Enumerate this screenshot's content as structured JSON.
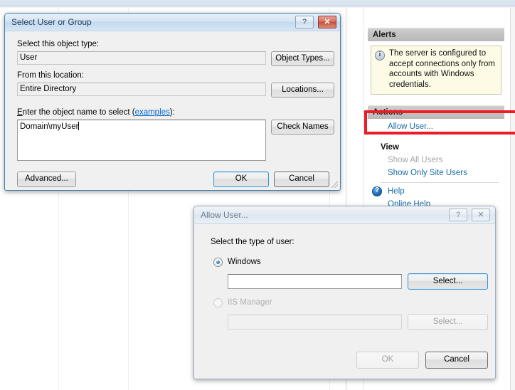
{
  "background": {
    "right_panel": {
      "alerts": {
        "header": "Alerts",
        "icon": "info-icon",
        "message": "The server is configured to accept connections only from accounts with Windows credentials."
      },
      "actions": {
        "header": "Actions",
        "items": [
          {
            "label": "Allow User...",
            "state": "enabled",
            "highlighted": true
          },
          {
            "label": "View",
            "state": "group-title"
          },
          {
            "label": "Show All Users",
            "state": "disabled"
          },
          {
            "label": "Show Only Site Users",
            "state": "enabled"
          }
        ],
        "help": {
          "icon": "help-icon",
          "label": "Help",
          "online_label": "Online Help"
        }
      }
    },
    "highlight_color": "#ee1b24"
  },
  "dialog_select_user": {
    "title": "Select User or Group",
    "titlebar": {
      "help_button": "?",
      "close_button": "✕"
    },
    "object_type": {
      "label": "Select this object type:",
      "value": "User",
      "button": "Object Types..."
    },
    "location": {
      "label": "From this location:",
      "value": "Entire Directory",
      "button": "Locations..."
    },
    "object_name": {
      "label_before": "E",
      "label_mid": "nter the object name to select (",
      "label_link": "examples",
      "label_after": "):",
      "value": "Domain\\myUser",
      "button": "Check Names"
    },
    "footer": {
      "advanced": "Advanced...",
      "ok": "OK",
      "cancel": "Cancel"
    }
  },
  "dialog_allow_user": {
    "title": "Allow User...",
    "titlebar": {
      "help_button": "?",
      "close_button": "✕"
    },
    "prompt": "Select the type of user:",
    "options": [
      {
        "id": "windows",
        "label": "Windows",
        "checked": true,
        "disabled": false,
        "input_value": "",
        "select_button": "Select..."
      },
      {
        "id": "iis-manager",
        "label": "IIS Manager",
        "checked": false,
        "disabled": true,
        "input_value": "",
        "select_button": "Select..."
      }
    ],
    "footer": {
      "ok": "OK",
      "cancel": "Cancel"
    }
  }
}
